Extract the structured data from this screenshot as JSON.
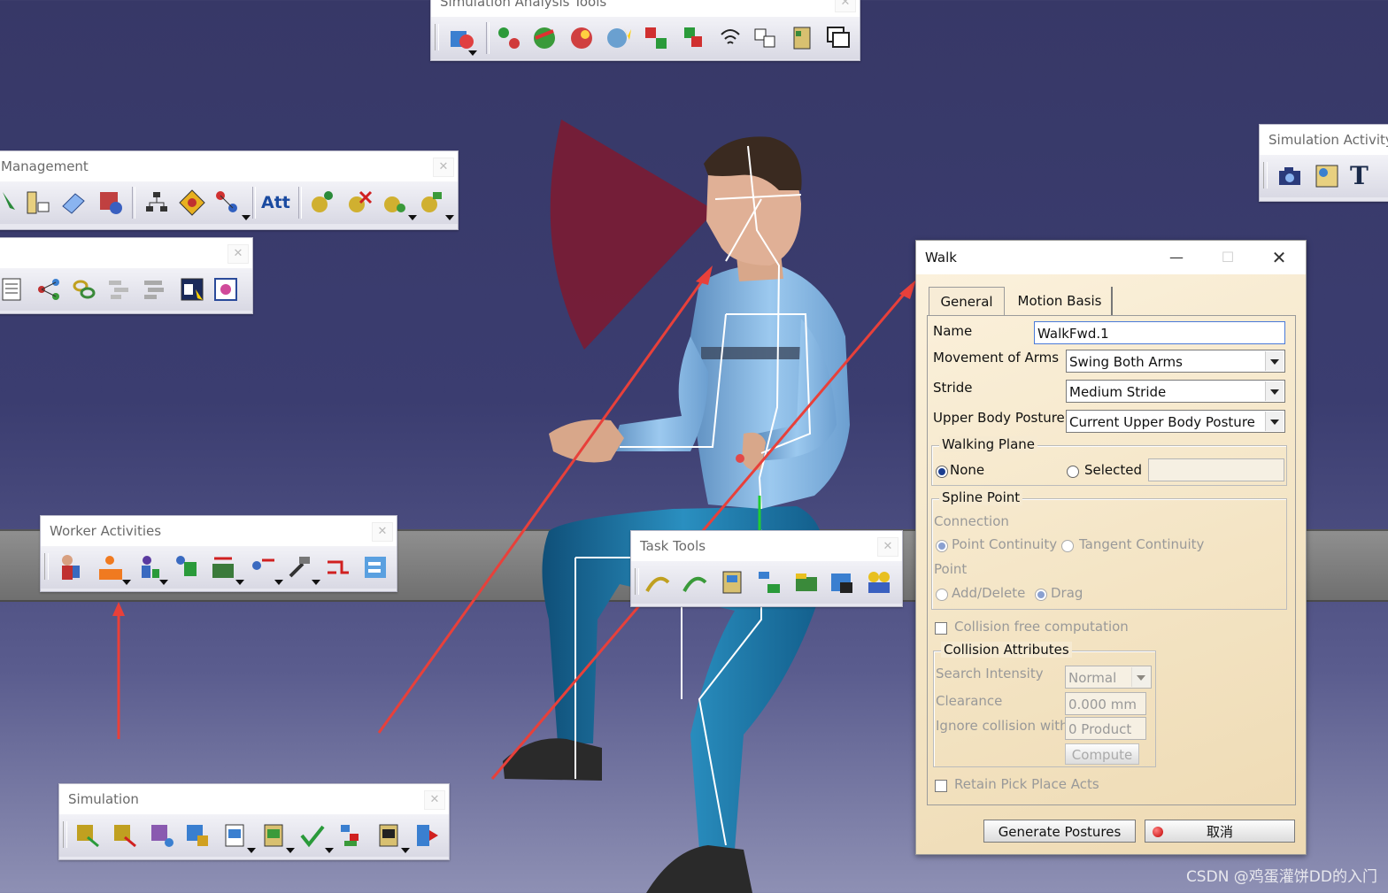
{
  "toolbars": {
    "sim_analysis": {
      "title": "Simulation Analysis Tools"
    },
    "management": {
      "title": "Management",
      "att_label": "Att"
    },
    "worker": {
      "title": "Worker Activities"
    },
    "task": {
      "title": "Task Tools"
    },
    "simulation": {
      "title": "Simulation"
    },
    "sim_activity": {
      "title": "Simulation Activity",
      "text_tool": "T"
    }
  },
  "dialog": {
    "title": "Walk",
    "tabs": [
      "General",
      "Motion Basis"
    ],
    "name_label": "Name",
    "name_value": "WalkFwd.1",
    "arms_label": "Movement of Arms",
    "arms_value": "Swing Both Arms",
    "stride_label": "Stride",
    "stride_value": "Medium Stride",
    "posture_label": "Upper Body Posture",
    "posture_value": "Current Upper Body Posture",
    "walking_plane": {
      "title": "Walking Plane",
      "none": "None",
      "selected": "Selected"
    },
    "spline": {
      "title": "Spline Point",
      "connection": "Connection",
      "point_cont": "Point Continuity",
      "tangent_cont": "Tangent Continuity",
      "point": "Point",
      "add_delete": "Add/Delete",
      "drag": "Drag"
    },
    "collision_free": "Collision free computation",
    "collision": {
      "title": "Collision Attributes",
      "intensity_label": "Search Intensity",
      "intensity_value": "Normal",
      "clearance_label": "Clearance",
      "clearance_value": "0.000 mm",
      "ignore_label": "Ignore collision with",
      "ignore_value": "0 Product",
      "compute": "Compute"
    },
    "retain": "Retain Pick Place Acts",
    "generate": "Generate Postures",
    "cancel": "取消"
  },
  "watermark": "CSDN @鸡蛋灌饼DD的入门",
  "colors": {
    "annotation_arrow": "#e8403a",
    "cone": "#7a1c34",
    "shirt": "#7fb1de",
    "pants": "#1a6f9c"
  }
}
